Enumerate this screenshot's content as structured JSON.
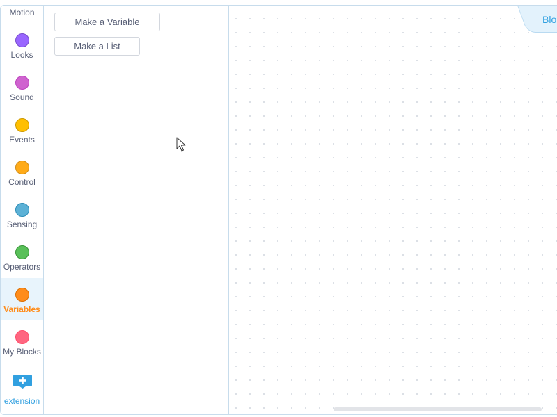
{
  "categories": [
    {
      "id": "motion",
      "label": "Motion",
      "color": "#4c97ff"
    },
    {
      "id": "looks",
      "label": "Looks",
      "color": "#9966ff"
    },
    {
      "id": "sound",
      "label": "Sound",
      "color": "#cf63cf"
    },
    {
      "id": "events",
      "label": "Events",
      "color": "#ffbf00"
    },
    {
      "id": "control",
      "label": "Control",
      "color": "#ffab19"
    },
    {
      "id": "sensing",
      "label": "Sensing",
      "color": "#5cb1d6"
    },
    {
      "id": "operators",
      "label": "Operators",
      "color": "#59c059"
    },
    {
      "id": "variables",
      "label": "Variables",
      "color": "#ff8c1a",
      "selected": true
    },
    {
      "id": "myblocks",
      "label": "My Blocks",
      "color": "#ff6680"
    }
  ],
  "extension": {
    "label": "extension",
    "icon": "add-extension-icon",
    "color": "#31a0e0"
  },
  "palette": {
    "make_variable_label": "Make a Variable",
    "make_list_label": "Make a List"
  },
  "workspace": {
    "tab_label": "Blo"
  },
  "colors": {
    "accent": "#31a0e0",
    "selected_text": "#ff8c1a",
    "text": "#575e75",
    "border": "#c7dcec"
  }
}
